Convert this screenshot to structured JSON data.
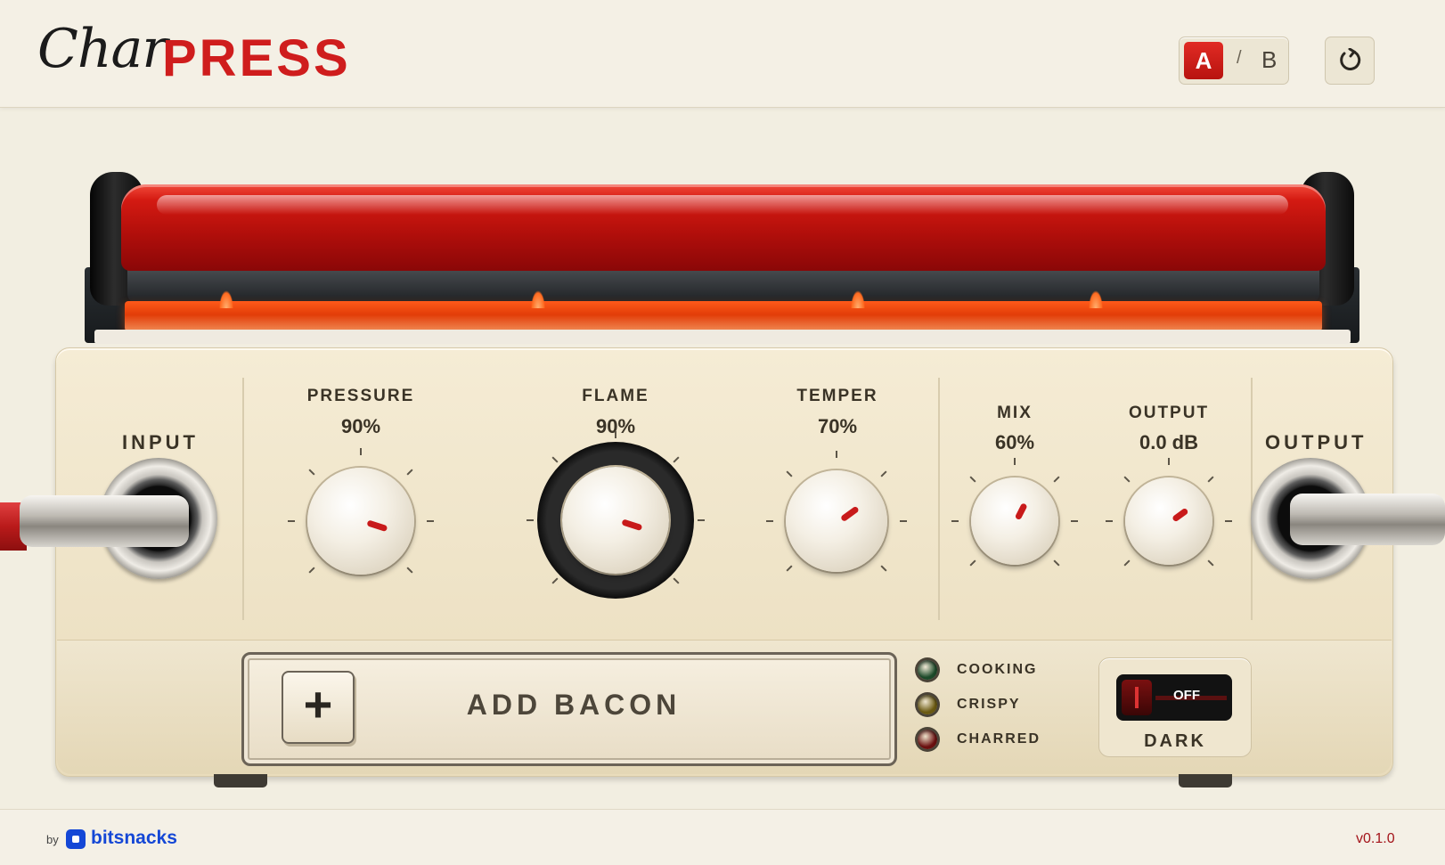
{
  "app": {
    "logo_script": "Char",
    "logo_bold": "PRESS"
  },
  "header": {
    "ab_a": "A",
    "ab_sep": "/",
    "ab_b": "B",
    "reset_icon": "reset-icon"
  },
  "io": {
    "input_label": "INPUT",
    "output_label": "OUTPUT"
  },
  "knobs": {
    "pressure": {
      "label": "PRESSURE",
      "value": "90%",
      "level": 0.9
    },
    "flame": {
      "label": "FLAME",
      "value": "90%",
      "level": 0.9
    },
    "temper": {
      "label": "TEMPER",
      "value": "70%",
      "level": 0.7
    },
    "mix": {
      "label": "MIX",
      "value": "60%",
      "level": 0.6
    },
    "output": {
      "label": "OUTPUT",
      "value": "0.0 dB",
      "level": 0.7
    }
  },
  "bacon": {
    "plus": "+",
    "label": "ADD BACON"
  },
  "status": [
    {
      "label": "COOKING",
      "color": "#1d4a2a"
    },
    {
      "label": "CRISPY",
      "color": "#6b5a12"
    },
    {
      "label": "CHARRED",
      "color": "#6b1010"
    }
  ],
  "dark": {
    "switch_text": "OFF",
    "label": "DARK"
  },
  "footer": {
    "by": "by",
    "brand": "bitsnacks",
    "version": "v0.1.0"
  },
  "colors": {
    "accent": "#cf1d1d",
    "brand": "#1447d6"
  }
}
